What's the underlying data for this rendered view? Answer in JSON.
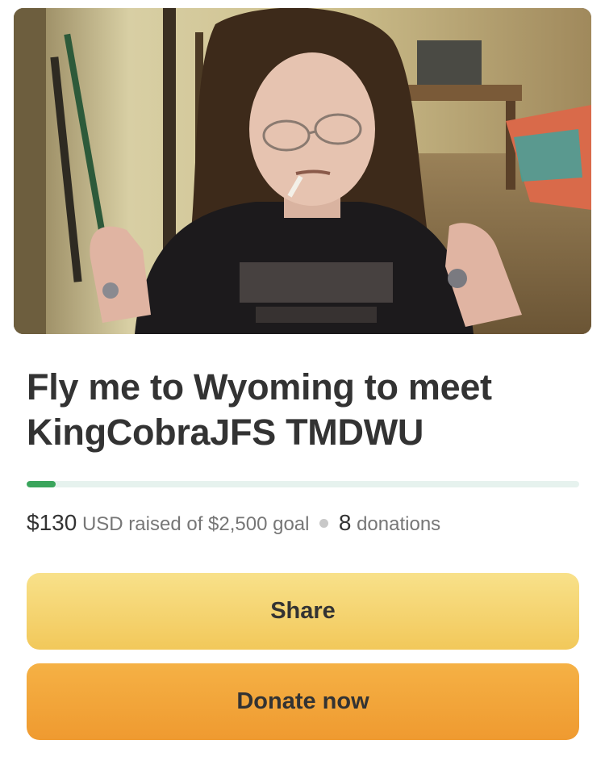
{
  "campaign": {
    "photo_alt": "Campaign photo",
    "title": "Fly me to Wyoming to meet KingCobraJFS TMDWU",
    "progress_fraction": 0.052,
    "raised_amount": "$130",
    "raised_text": "USD raised of $2,500 goal",
    "donation_count": "8",
    "donations_label": "donations"
  },
  "actions": {
    "share_label": "Share",
    "donate_label": "Donate now"
  },
  "colors": {
    "progress_fill": "#3aa55c",
    "progress_track": "#e6f2ee",
    "share_button": "#f2c85a",
    "donate_button": "#ef9a30",
    "text_primary": "#333333",
    "text_secondary": "#767676"
  }
}
